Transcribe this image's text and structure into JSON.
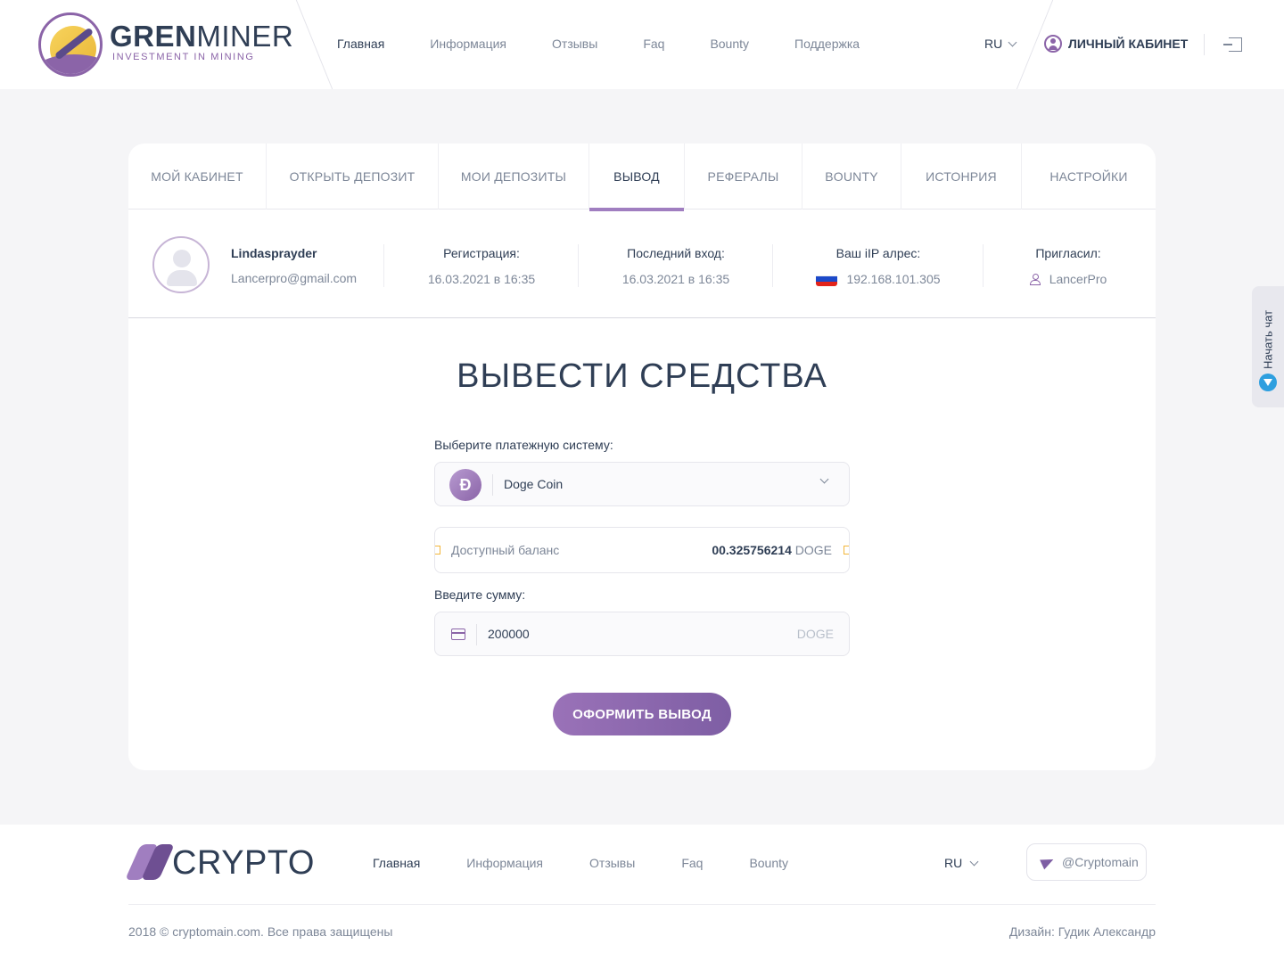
{
  "header": {
    "logo_title_bold": "GREN",
    "logo_title_thin": "MINER",
    "logo_subtitle": "INVESTMENT IN MINING",
    "nav": [
      "Главная",
      "Информация",
      "Отзывы",
      "Faq",
      "Bounty",
      "Поддержка"
    ],
    "lang": "RU",
    "cabinet": "ЛИЧНЫЙ КАБИНЕТ"
  },
  "tabs": [
    "МОЙ КАБИНЕТ",
    "ОТКРЫТЬ ДЕПОЗИТ",
    "МОИ ДЕПОЗИТЫ",
    "ВЫВОД",
    "РЕФЕРАЛЫ",
    "BOUNTY",
    "ИСТОНРИЯ",
    "НАСТРОЙКИ"
  ],
  "active_tab": "ВЫВОД",
  "profile": {
    "name": "Lindasprayder",
    "email": "Lancerpro@gmail.com",
    "reg_label": "Регистрация:",
    "reg_value": "16.03.2021 в 16:35",
    "last_label": "Последний вход:",
    "last_value": "16.03.2021 в 16:35",
    "ip_label": "Ваш iIP алрес:",
    "ip_value": "192.168.101.305",
    "invited_label": "Пригласил:",
    "invited_value": "LancerPro"
  },
  "withdraw": {
    "title": "ВЫВЕСТИ СРЕДСТВА",
    "system_label": "Выберите платежную систему:",
    "system_value": "Doge Coin",
    "coin_symbol": "Ð",
    "balance_label": "Доступный баланс",
    "balance_amount": "00.325756214",
    "balance_unit": "DOGE",
    "amount_label": "Введите сумму:",
    "amount_value": "200000",
    "amount_unit": "DOGE",
    "submit": "ОФОРМИТЬ ВЫВОД"
  },
  "chat": {
    "label": "Начать чат"
  },
  "footer": {
    "logo": "CRYPTO",
    "nav": [
      "Главная",
      "Информация",
      "Отзывы",
      "Faq",
      "Bounty"
    ],
    "lang": "RU",
    "telegram": "@Cryptomain",
    "copyright": "2018 © cryptomain.com.  Все права защищены",
    "design": "Дизайн: Гудик Александр"
  },
  "colors": {
    "accent": "#8b64a8",
    "text_dark": "#2f3e55",
    "text_muted": "#7d8798",
    "background": "#f5f5f7"
  }
}
